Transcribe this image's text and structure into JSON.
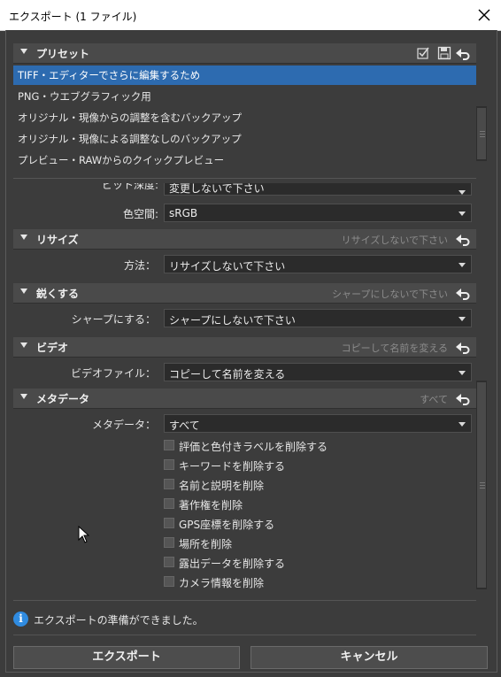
{
  "window": {
    "title": "エクスポート (1 ファイル)",
    "close_glyph": "✕"
  },
  "presets": {
    "header": "プリセット",
    "items": [
      "TIFF・エディターでさらに編集するため",
      "PNG・ウエブグラフィック用",
      "オリジナル・現像からの調整を含むバックアップ",
      "オリジナル・現像による調整なしのバックアップ",
      "プレビュー・RAWからのクイックプレビュー"
    ],
    "selected_index": 0,
    "icons": [
      "checklist-icon",
      "save-icon",
      "undo-icon"
    ]
  },
  "format": {
    "partial_label": "ビット深度:",
    "partial_value": "変更しないで下さい",
    "color_space_label": "色空間:",
    "color_space_value": "sRGB"
  },
  "resize": {
    "header": "リサイズ",
    "hint": "リサイズしないで下さい",
    "method_label": "方法：",
    "method_value": "リサイズしないで下さい"
  },
  "sharpen": {
    "header": "鋭くする",
    "hint": "シャープにしないで下さい",
    "label": "シャープにする：",
    "value": "シャープにしないで下さい"
  },
  "video": {
    "header": "ビデオ",
    "hint": "コピーして名前を変える",
    "label": "ビデオファイル：",
    "value": "コピーして名前を変える"
  },
  "metadata": {
    "header": "メタデータ",
    "hint": "すべて",
    "label": "メタデータ：",
    "value": "すべて",
    "options": [
      "評価と色付きラベルを削除する",
      "キーワードを削除する",
      "名前と説明を削除",
      "著作権を削除",
      "GPS座標を削除する",
      "場所を削除",
      "露出データを削除する",
      "カメラ情報を削除"
    ]
  },
  "status": {
    "icon_glyph": "i",
    "text": "エクスポートの準備ができました。"
  },
  "buttons": {
    "export": "エクスポート",
    "cancel": "キャンセル"
  },
  "colors": {
    "selection": "#2d6bb0",
    "info": "#2f8be0",
    "background": "#3c3c3c"
  }
}
